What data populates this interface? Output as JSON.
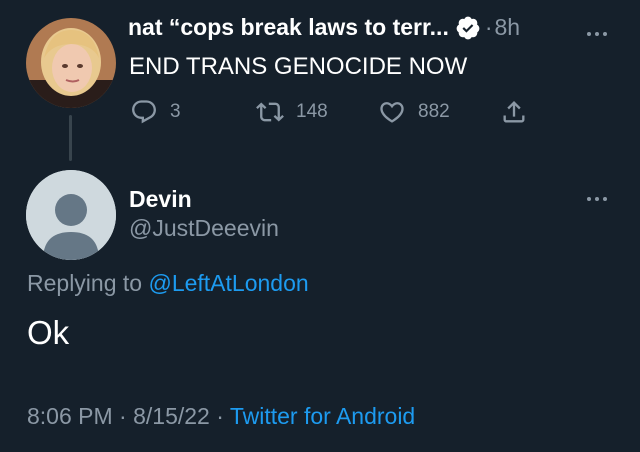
{
  "parent_tweet": {
    "display_name": "nat “cops break laws to terr...",
    "time_separator": "·",
    "time": "8h",
    "text": "END TRANS GENOCIDE NOW",
    "avatar_icon": "user-photo",
    "verified_icon": "verified-badge-icon",
    "stats": {
      "replies": "3",
      "retweets": "148",
      "likes": "882"
    }
  },
  "reply_tweet": {
    "display_name": "Devin",
    "handle": "@JustDeeevin",
    "avatar_icon": "default-avatar-icon",
    "replying_prefix": "Replying to ",
    "replying_mention": "@LeftAtLondon",
    "text": "Ok",
    "timestamp": "8:06 PM · 8/15/22 · ",
    "source": "Twitter for Android"
  },
  "colors": {
    "background": "#15202b",
    "primary_text": "#ffffff",
    "secondary_text": "#8b98a5",
    "accent": "#1d9bf0",
    "thread_line": "#38444d"
  }
}
